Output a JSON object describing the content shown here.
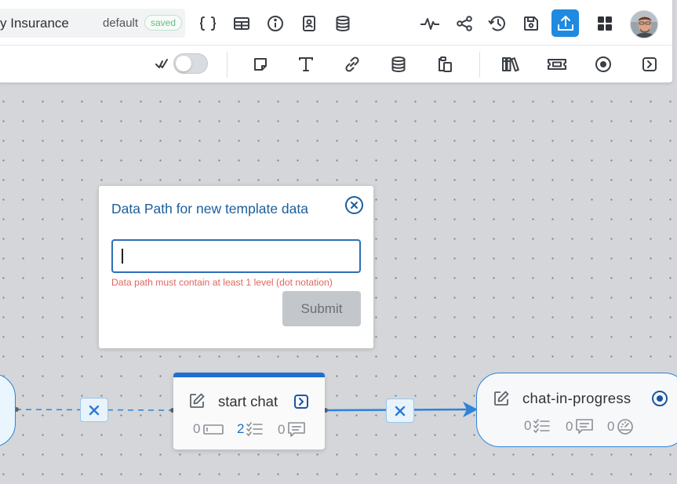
{
  "header": {
    "flow_title": "y Insurance",
    "version": "default",
    "status_badge": "saved"
  },
  "dialog": {
    "title": "Data Path for new template data",
    "input_value": "",
    "error": "Data path must contain at least 1 level (dot notation)",
    "submit_label": "Submit"
  },
  "nodes": {
    "start": {
      "name": "start chat",
      "stats": [
        "0",
        "2",
        "0"
      ]
    },
    "chat": {
      "name": "chat-in-progress",
      "stats": [
        "0",
        "0",
        "0"
      ]
    }
  },
  "colors": {
    "accent": "#1f8ae0",
    "dialog_title": "#1c5e9e",
    "error": "#e0665f",
    "edge": "#2f82d9"
  },
  "icons": {
    "row1": [
      "braces-icon",
      "table-icon",
      "info-icon",
      "contact-card-icon",
      "database-icon",
      "activity-icon",
      "share-icon",
      "history-icon",
      "save-icon",
      "publish-icon",
      "apps-grid-icon"
    ],
    "row2": [
      "check-all-icon",
      "sticky-note-icon",
      "text-icon",
      "link-icon",
      "database-icon",
      "paste-icon",
      "library-icon",
      "ticket-icon",
      "radio-target-icon",
      "arrow-right-box-icon"
    ]
  }
}
